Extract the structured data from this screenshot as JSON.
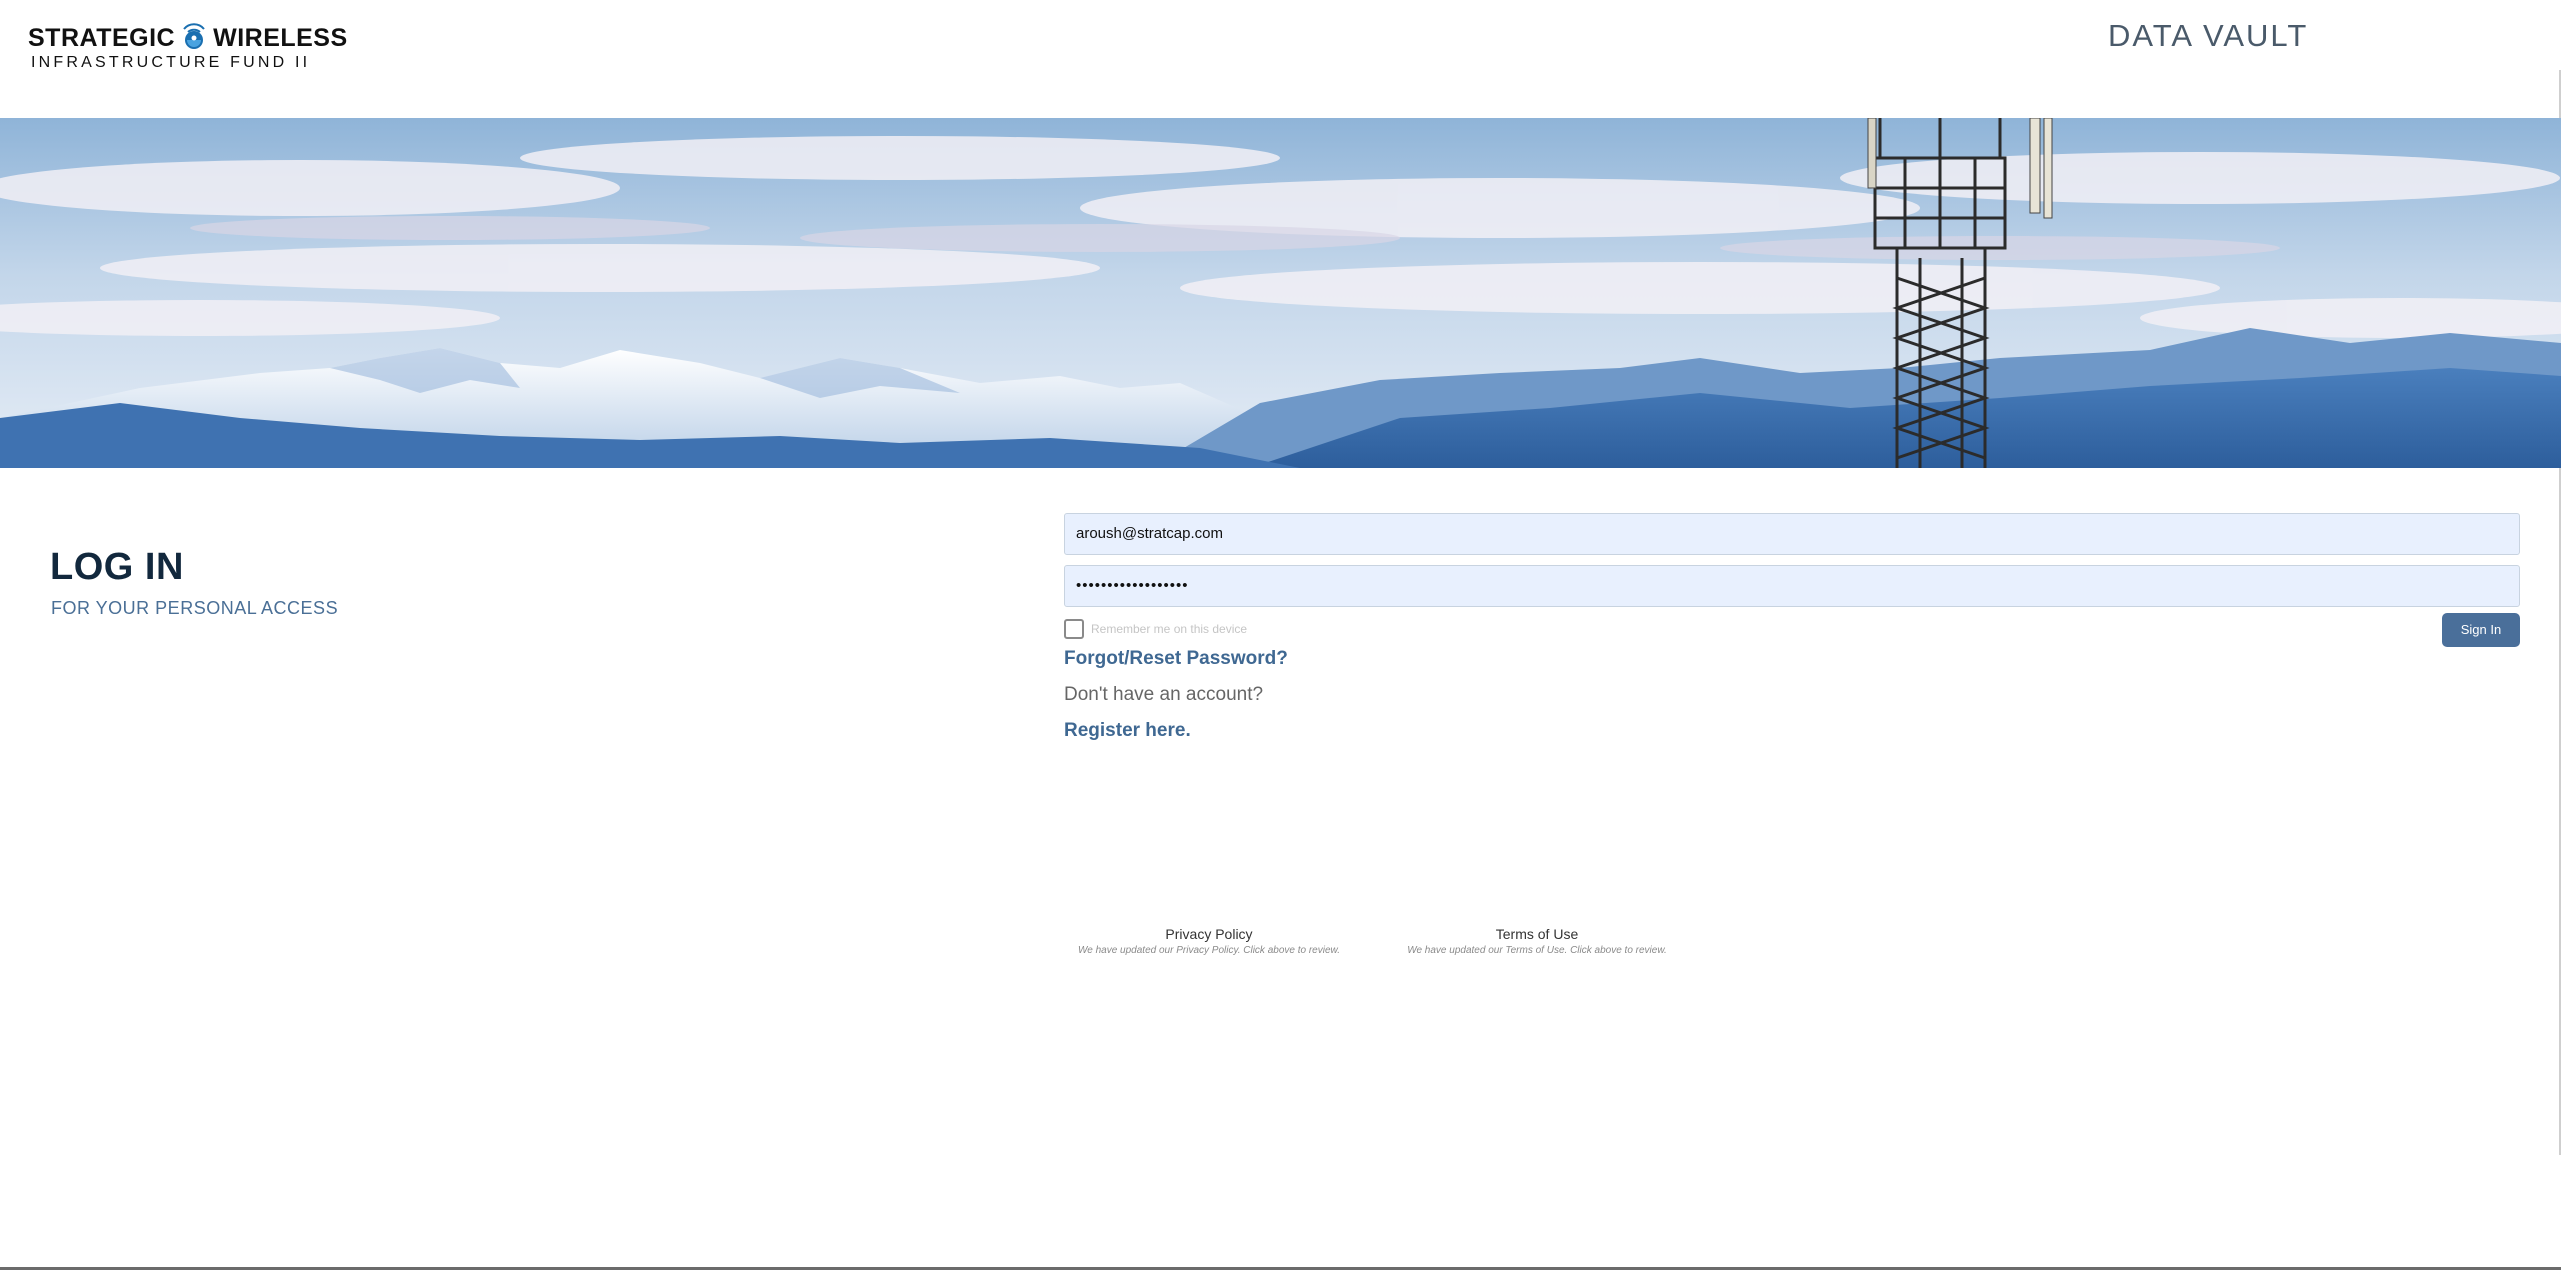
{
  "header": {
    "logo": {
      "line1_left": "STRATEGIC",
      "line1_right": "WIRELESS",
      "line2": "INFRASTRUCTURE FUND II"
    },
    "title": "DATA VAULT"
  },
  "login": {
    "heading": "LOG IN",
    "subheading": "FOR YOUR PERSONAL ACCESS"
  },
  "form": {
    "email_value": "aroush@stratcap.com",
    "password_value": "••••••••••••••••••",
    "remember_label": "Remember me on this device",
    "remember_checked": false,
    "signin_label": "Sign In",
    "forgot_label": "Forgot/Reset Password?",
    "no_account_text": "Don't have an account?",
    "register_label": "Register here."
  },
  "footer_links": {
    "privacy": {
      "label": "Privacy Policy",
      "note": "We have updated our Privacy Policy. Click above to review."
    },
    "terms": {
      "label": "Terms of Use",
      "note": "We have updated our Terms of Use. Click above to review."
    }
  },
  "colors": {
    "accent": "#4a6f9a",
    "link": "#3f6892",
    "heading": "#12283d",
    "field_bg": "#e8f0fe"
  }
}
